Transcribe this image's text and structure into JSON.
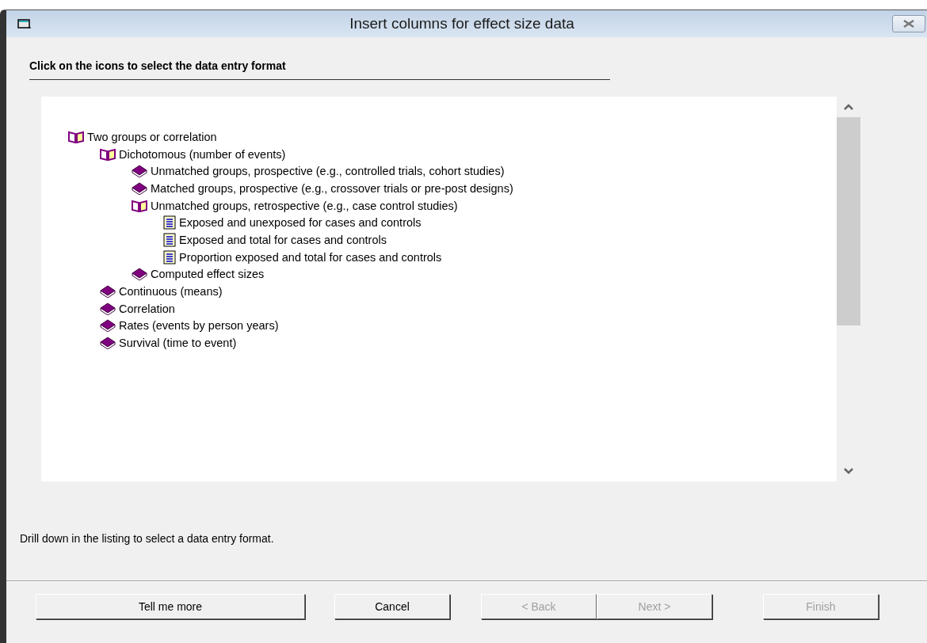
{
  "window": {
    "title": "Insert columns for effect size data"
  },
  "heading": "Click on the icons to select the data entry format",
  "tree": [
    {
      "label": "Two groups or correlation",
      "kind": "open",
      "children": [
        {
          "label": "Dichotomous (number of events)",
          "kind": "open",
          "children": [
            {
              "label": "Unmatched groups, prospective (e.g., controlled trials, cohort studies)",
              "kind": "closed"
            },
            {
              "label": "Matched groups, prospective (e.g., crossover trials or pre-post designs)",
              "kind": "closed"
            },
            {
              "label": "Unmatched groups, retrospective (e.g., case control studies)",
              "kind": "open",
              "children": [
                {
                  "label": "Exposed and unexposed for cases and controls",
                  "kind": "doc"
                },
                {
                  "label": "Exposed and total for cases and controls",
                  "kind": "doc"
                },
                {
                  "label": "Proportion exposed and total for cases and controls",
                  "kind": "doc"
                }
              ]
            },
            {
              "label": "Computed effect sizes",
              "kind": "closed"
            }
          ]
        },
        {
          "label": "Continuous (means)",
          "kind": "closed"
        },
        {
          "label": "Correlation",
          "kind": "closed"
        },
        {
          "label": "Rates (events by person years)",
          "kind": "closed"
        },
        {
          "label": "Survival (time to event)",
          "kind": "closed"
        }
      ]
    }
  ],
  "status": "Drill down in the listing to select a data entry format.",
  "buttons": [
    {
      "label": "Tell me more",
      "disabled": false
    },
    {
      "label": "Cancel",
      "disabled": false
    },
    {
      "label": "< Back",
      "disabled": true
    },
    {
      "label": "Next >",
      "disabled": true
    },
    {
      "label": "Finish",
      "disabled": true
    }
  ]
}
